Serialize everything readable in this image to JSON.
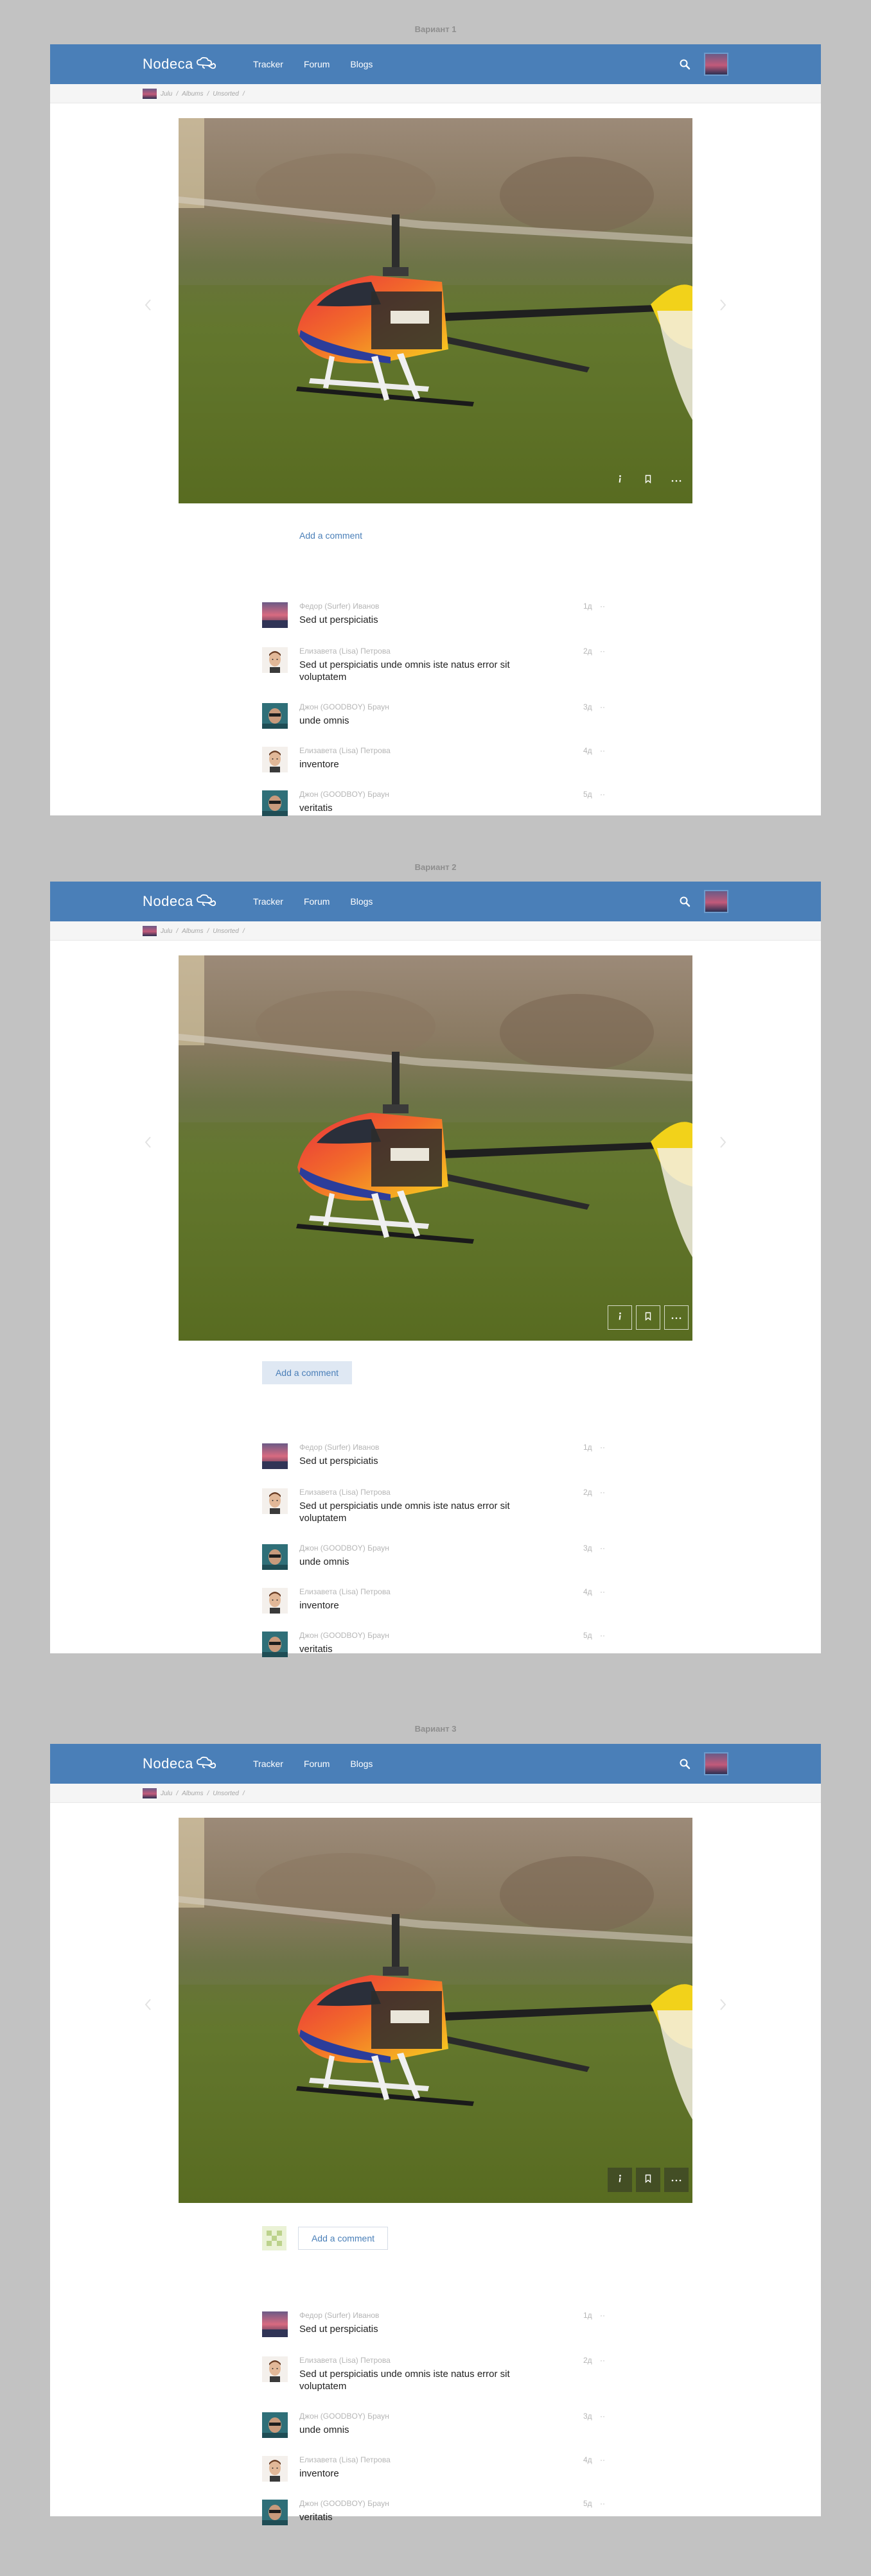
{
  "variants": [
    {
      "title": "Вариант 1",
      "style": "plain"
    },
    {
      "title": "Вариант 2",
      "style": "button"
    },
    {
      "title": "Вариант 3",
      "style": "avatar"
    }
  ],
  "nav": {
    "logo": "Nodeca",
    "links": [
      "Tracker",
      "Forum",
      "Blogs"
    ],
    "search_icon": "search-icon",
    "avatar": "user-avatar"
  },
  "breadcrumbs": [
    "Julu",
    "Albums",
    "Unsorted"
  ],
  "photo": {
    "subject": "helicopter-photo"
  },
  "toolbar": {
    "icons": [
      "info-icon",
      "bookmark-icon",
      "more-icon"
    ]
  },
  "add_comment_label": "Add a comment",
  "comments": [
    {
      "author": "Федор (Surfer) Иванов",
      "text": "Sed ut perspiciatis",
      "time": "1д",
      "more": "··",
      "avatar": "sunset"
    },
    {
      "author": "Елизавета (Lisa) Петрова",
      "text": "Sed ut perspiciatis unde omnis iste natus error sit voluptatem",
      "time": "2д",
      "more": "··",
      "avatar": "face"
    },
    {
      "author": "Джон (GOODBOY) Браун",
      "text": "unde omnis",
      "time": "3д",
      "more": "··",
      "avatar": "teal"
    },
    {
      "author": "Елизавета (Lisa) Петрова",
      "text": "inventore",
      "time": "4д",
      "more": "··",
      "avatar": "face"
    },
    {
      "author": "Джон (GOODBOY) Браун",
      "text": "veritatis",
      "time": "5д",
      "more": "··",
      "avatar": "teal"
    }
  ],
  "colors": {
    "navbar": "#4a7fb8",
    "link": "#4a7fb8",
    "page": "#c2c2c2"
  }
}
